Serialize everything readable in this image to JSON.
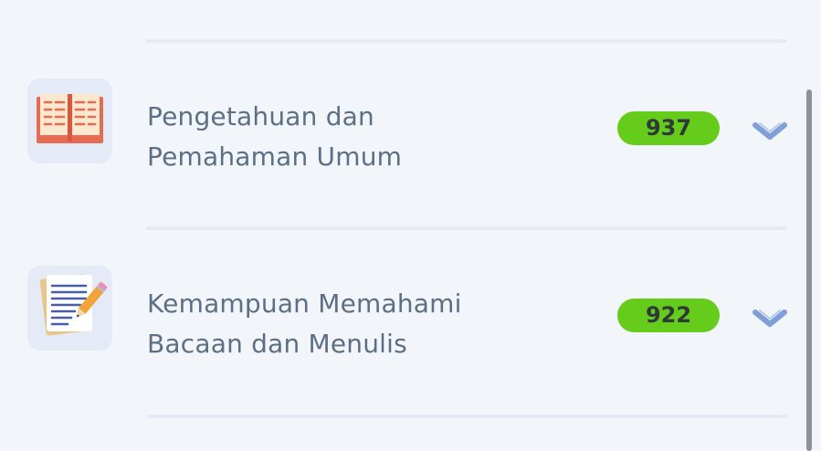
{
  "subjects": [
    {
      "icon": "open-book-icon",
      "title_line1": "Pengetahuan dan",
      "title_line2": "Pemahaman Umum",
      "score": "937"
    },
    {
      "icon": "writing-paper-icon",
      "title_line1": "Kemampuan Memahami",
      "title_line2": "Bacaan dan Menulis",
      "score": "922"
    }
  ],
  "colors": {
    "badge": "#66cc1c",
    "label": "#5c6f87",
    "chevron": "#7f9fd6",
    "background": "#f2f5f9"
  }
}
